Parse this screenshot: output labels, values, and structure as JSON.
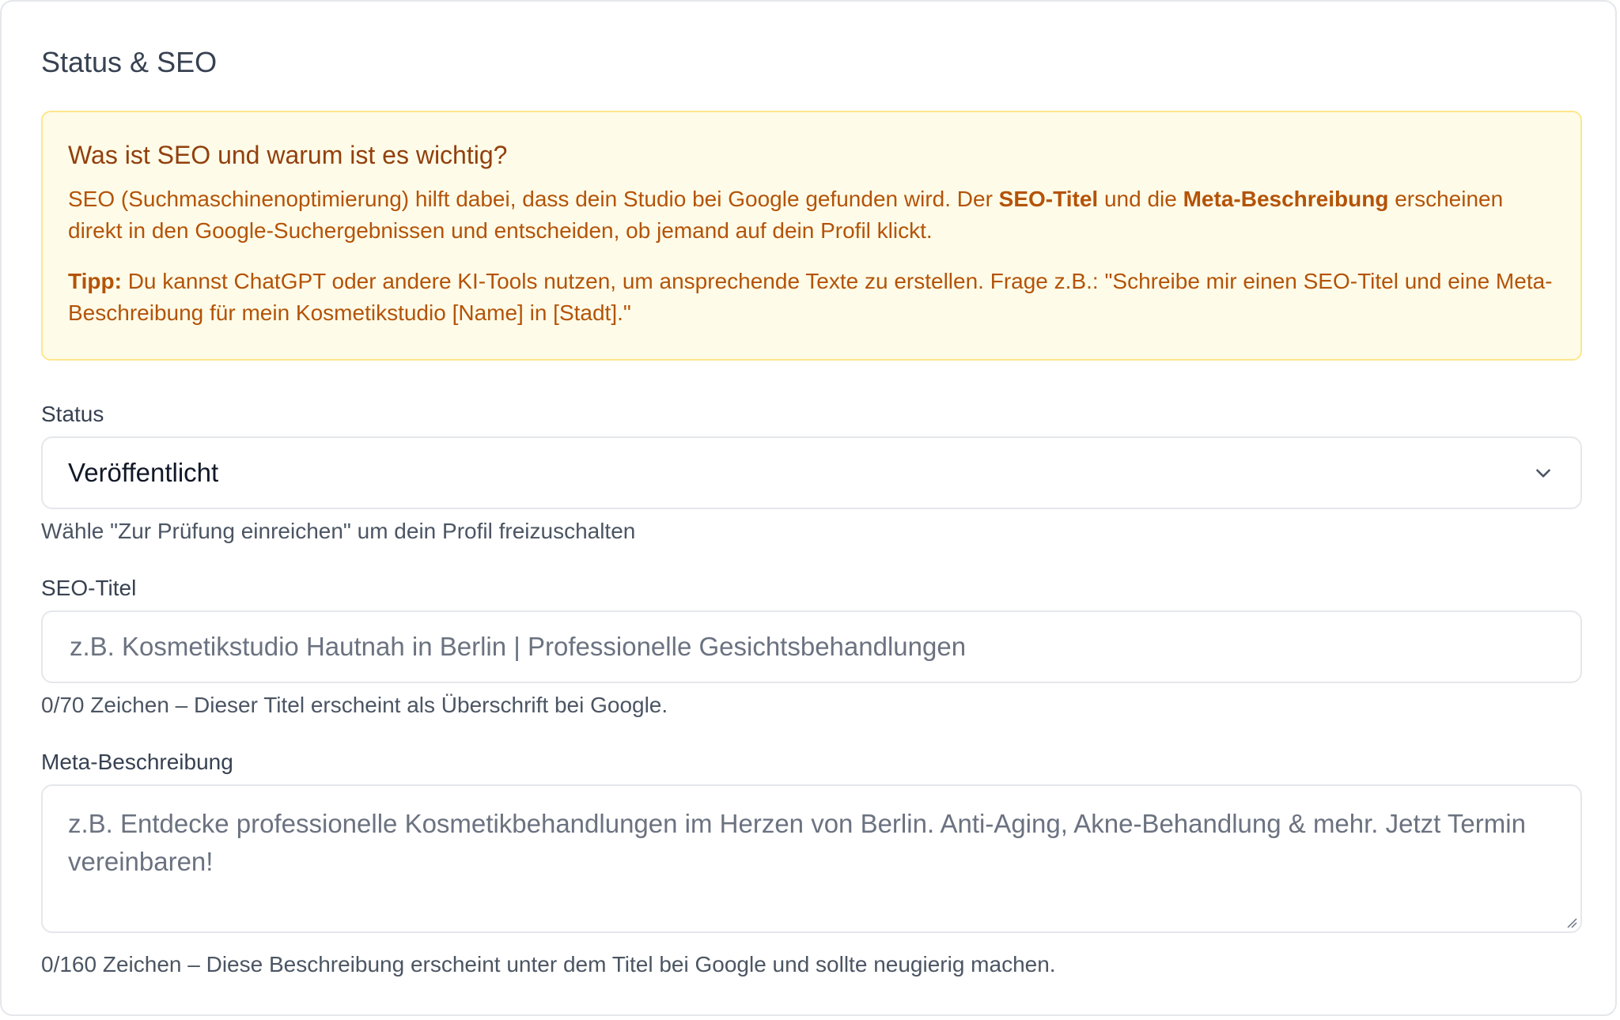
{
  "card": {
    "title": "Status & SEO"
  },
  "info": {
    "heading": "Was ist SEO und warum ist es wichtig?",
    "para1_start": "SEO (Suchmaschinenoptimierung) hilft dabei, dass dein Studio bei Google gefunden wird. Der ",
    "para1_bold1": "SEO-Titel",
    "para1_mid": " und die ",
    "para1_bold2": "Meta-Beschreibung",
    "para1_end": " erscheinen direkt in den Google-Suchergebnissen und entscheiden, ob jemand auf dein Profil klickt.",
    "tip_label": "Tipp:",
    "tip_text": " Du kannst ChatGPT oder andere KI-Tools nutzen, um ansprechende Texte zu erstellen. Frage z.B.: \"Schreibe mir einen SEO-Titel und eine Meta-Beschreibung für mein Kosmetikstudio [Name] in [Stadt].\""
  },
  "status": {
    "label": "Status",
    "selected": "Veröffentlicht",
    "help": "Wähle \"Zur Prüfung einreichen\" um dein Profil freizuschalten"
  },
  "seo_title": {
    "label": "SEO-Titel",
    "value": "",
    "placeholder": "z.B. Kosmetikstudio Hautnah in Berlin | Professionelle Gesichtsbehandlungen",
    "help": "0/70 Zeichen – Dieser Titel erscheint als Überschrift bei Google."
  },
  "meta_description": {
    "label": "Meta-Beschreibung",
    "value": "",
    "placeholder": "z.B. Entdecke professionelle Kosmetikbehandlungen im Herzen von Berlin. Anti-Aging, Akne-Behandlung & mehr. Jetzt Termin vereinbaren!",
    "help": "0/160 Zeichen – Diese Beschreibung erscheint unter dem Titel bei Google und sollte neugierig machen."
  },
  "icons": {
    "select": "chevron-down-icon",
    "textarea": "resize-grip-icon"
  }
}
